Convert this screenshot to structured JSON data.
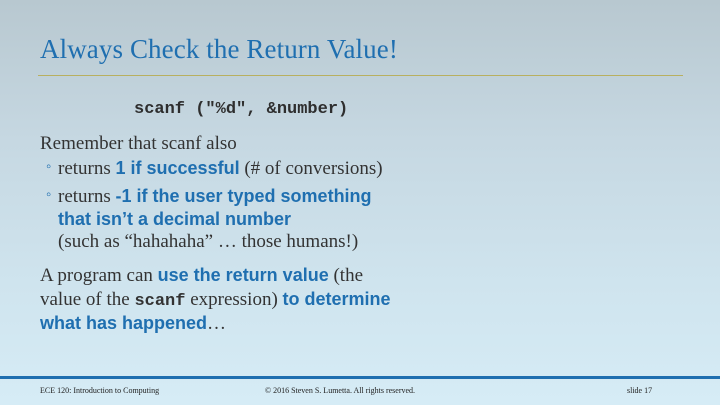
{
  "slide": {
    "title": "Always Check the Return Value!",
    "code": "scanf (\"%d\", &number)",
    "intro": "Remember that scanf also",
    "bullet1": {
      "prefix": "returns ",
      "bold": "1 if successful",
      "suffix": " (# of conversions)"
    },
    "bullet2": {
      "prefix": "returns ",
      "bold_line1": "-1 if the user typed something",
      "bold_line2": "that isn’t a decimal number",
      "line3": "(such as “hahahaha” … those humans!)"
    },
    "conclusion": {
      "p1": "A program can ",
      "b1": "use the return value",
      "p2": " (the",
      "p3": "value of the ",
      "code": "scanf",
      "p4": " expression) ",
      "b2": "to determine",
      "b3": "what has happened",
      "p5": "…"
    }
  },
  "footer": {
    "course": "ECE 120: Introduction to Computing",
    "copyright": "© 2016 Steven S. Lumetta.  All rights reserved.",
    "slide_number": "slide 17"
  },
  "colors": {
    "accent": "#1f6fb0",
    "rule": "#b8b060"
  }
}
